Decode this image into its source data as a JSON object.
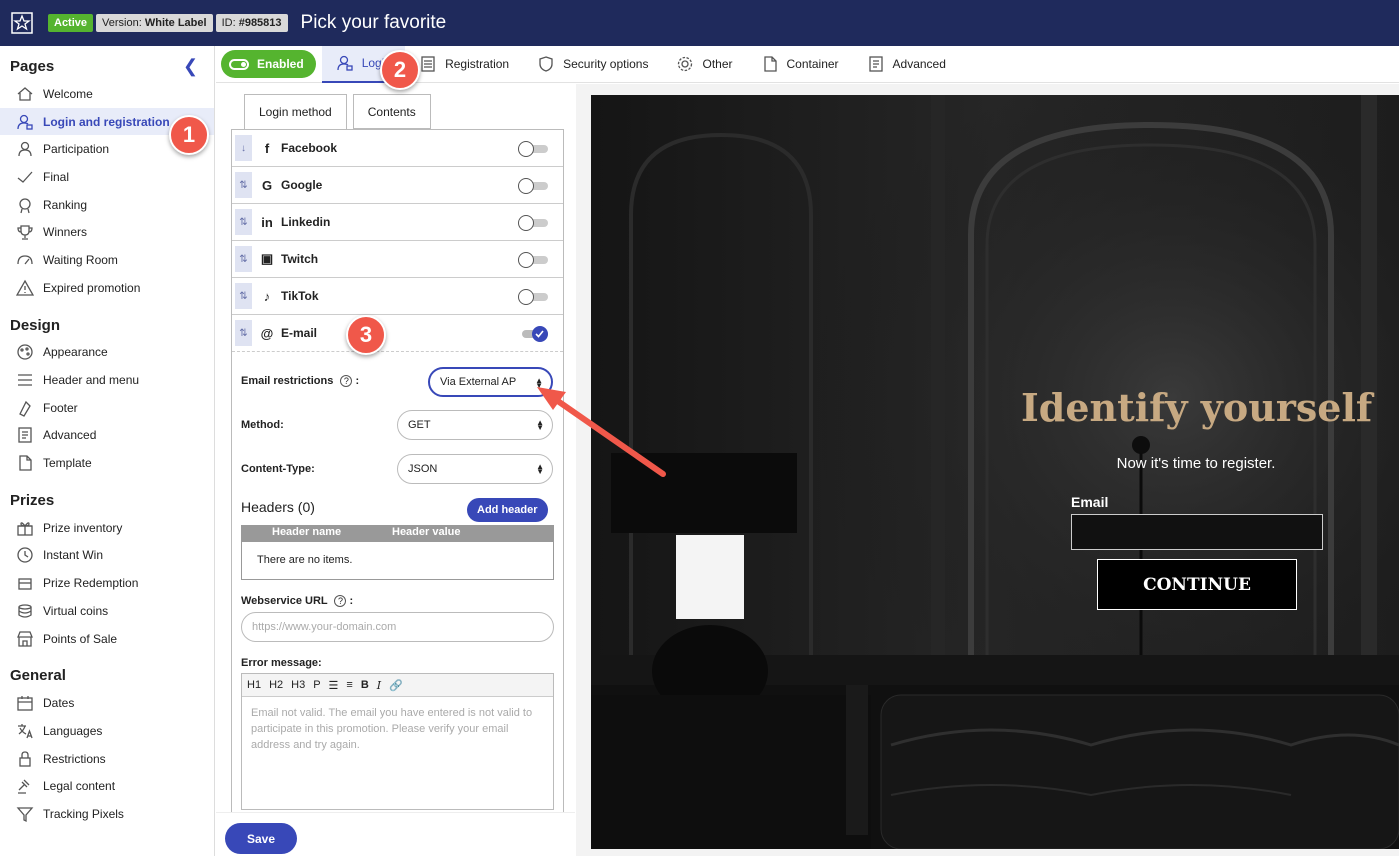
{
  "topbar": {
    "status_badge": "Active",
    "version_label": "Version:",
    "version_value": "White Label",
    "id_label": "ID:",
    "id_value": "#985813",
    "title": "Pick your favorite"
  },
  "sidebar": {
    "sections": [
      {
        "title": "Pages",
        "items": [
          {
            "label": "Welcome",
            "icon": "home-icon"
          },
          {
            "label": "Login and registration",
            "icon": "user-lock-icon",
            "active": true
          },
          {
            "label": "Participation",
            "icon": "participation-icon"
          },
          {
            "label": "Final",
            "icon": "check-icon"
          },
          {
            "label": "Ranking",
            "icon": "ranking-icon"
          },
          {
            "label": "Winners",
            "icon": "trophy-icon"
          },
          {
            "label": "Waiting Room",
            "icon": "gauge-icon"
          },
          {
            "label": "Expired promotion",
            "icon": "warning-icon"
          }
        ]
      },
      {
        "title": "Design",
        "items": [
          {
            "label": "Appearance",
            "icon": "palette-icon"
          },
          {
            "label": "Header and menu",
            "icon": "menu-icon"
          },
          {
            "label": "Footer",
            "icon": "footer-icon"
          },
          {
            "label": "Advanced",
            "icon": "advanced-icon"
          },
          {
            "label": "Template",
            "icon": "document-icon"
          }
        ]
      },
      {
        "title": "Prizes",
        "items": [
          {
            "label": "Prize inventory",
            "icon": "gift-icon"
          },
          {
            "label": "Instant Win",
            "icon": "clock-icon"
          },
          {
            "label": "Prize Redemption",
            "icon": "redeem-icon"
          },
          {
            "label": "Virtual coins",
            "icon": "coins-icon"
          },
          {
            "label": "Points of Sale",
            "icon": "store-icon"
          }
        ]
      },
      {
        "title": "General",
        "items": [
          {
            "label": "Dates",
            "icon": "calendar-icon"
          },
          {
            "label": "Languages",
            "icon": "translate-icon"
          },
          {
            "label": "Restrictions",
            "icon": "lock-icon"
          },
          {
            "label": "Legal content",
            "icon": "gavel-icon"
          },
          {
            "label": "Tracking Pixels",
            "icon": "filter-icon"
          }
        ]
      }
    ]
  },
  "tabs": {
    "enabled_label": "Enabled",
    "items": [
      {
        "label": "Login",
        "icon": "user-lock-icon",
        "active": true
      },
      {
        "label": "Registration",
        "icon": "form-icon"
      },
      {
        "label": "Security options",
        "icon": "shield-icon"
      },
      {
        "label": "Other",
        "icon": "gear-icon"
      },
      {
        "label": "Container",
        "icon": "document-icon"
      },
      {
        "label": "Advanced",
        "icon": "advanced-icon"
      }
    ]
  },
  "editor": {
    "subtabs": [
      "Login method",
      "Contents"
    ],
    "login_methods": [
      {
        "label": "Facebook",
        "glyph": "f",
        "enabled": false
      },
      {
        "label": "Google",
        "glyph": "G",
        "enabled": false
      },
      {
        "label": "Linkedin",
        "glyph": "in",
        "enabled": false
      },
      {
        "label": "Twitch",
        "glyph": "▣",
        "enabled": false
      },
      {
        "label": "TikTok",
        "glyph": "♪",
        "enabled": false
      },
      {
        "label": "E-mail",
        "glyph": "@",
        "enabled": true
      }
    ],
    "email_restrictions_label": "Email restrictions",
    "email_restrictions_value": "Via External AP",
    "method_label": "Method:",
    "method_value": "GET",
    "content_type_label": "Content-Type:",
    "content_type_value": "JSON",
    "headers_title": "Headers (0)",
    "add_header_label": "Add header",
    "header_col_name": "Header name",
    "header_col_value": "Header value",
    "no_items": "There are no items.",
    "webservice_url_label": "Webservice URL",
    "webservice_url_placeholder": "https://www.your-domain.com",
    "error_message_label": "Error message:",
    "toolbar": [
      "H1",
      "H2",
      "H3",
      "P",
      "☰",
      "≡",
      "B",
      "I",
      "🔗"
    ],
    "error_message_text": "Email not valid. The email you have entered is not valid to participate in this promotion. Please verify your email address and try again.",
    "save_label": "Save"
  },
  "preview": {
    "title": "Identify yourself",
    "subtitle": "Now it's time to register.",
    "email_label": "Email",
    "continue_label": "CONTINUE"
  },
  "annotations": {
    "step1": "1",
    "step2": "2",
    "step3": "3"
  },
  "colors": {
    "topbar": "#1f2a5c",
    "accent": "#3848b8",
    "enabled_green": "#55b42f",
    "annotation_red": "#f0584a",
    "preview_gold": "#c7a982"
  }
}
